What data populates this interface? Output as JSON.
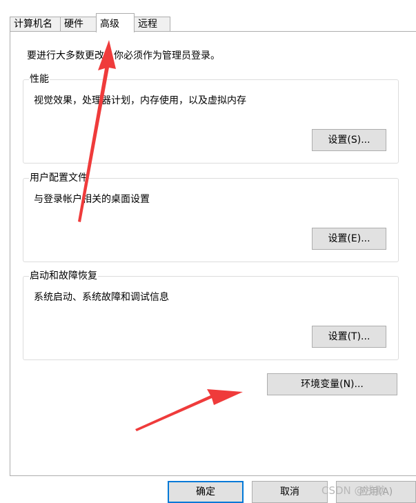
{
  "tabs": [
    {
      "label": "计算机名",
      "active": false
    },
    {
      "label": "硬件",
      "active": false
    },
    {
      "label": "高级",
      "active": true
    },
    {
      "label": "远程",
      "active": false
    }
  ],
  "admin_note": "要进行大多数更改，你必须作为管理员登录。",
  "groups": {
    "performance": {
      "title": "性能",
      "description": "视觉效果，处理器计划，内存使用，以及虚拟内存",
      "button": "设置(S)..."
    },
    "user_profiles": {
      "title": "用户配置文件",
      "description": "与登录帐户相关的桌面设置",
      "button": "设置(E)..."
    },
    "startup_recovery": {
      "title": "启动和故障恢复",
      "description": "系统启动、系统故障和调试信息",
      "button": "设置(T)..."
    }
  },
  "env_button": "环境变量(N)...",
  "footer": {
    "ok": "确定",
    "cancel": "取消",
    "apply": "应用(A)"
  },
  "watermark": "CSDN @浅默",
  "colors": {
    "annotation_arrow": "#ef3b3b",
    "button_face": "#e1e1e1",
    "button_border": "#adadad",
    "default_border": "#0078d7"
  }
}
